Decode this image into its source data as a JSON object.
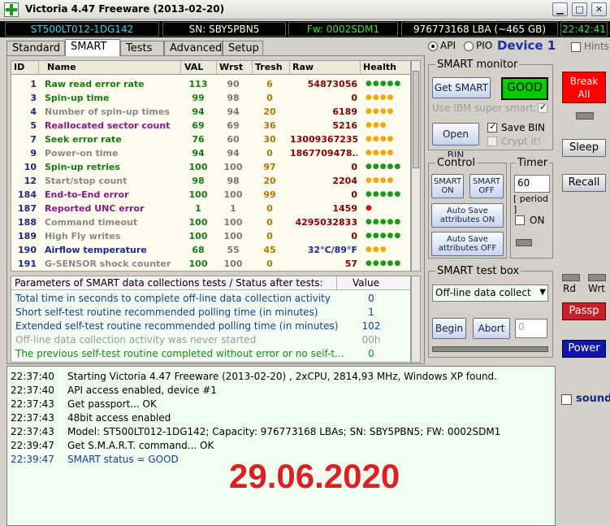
{
  "window": {
    "title": "Victoria 4.47  Freeware (2013-02-20)",
    "min_glyph": "▁",
    "max_glyph": "□",
    "close_glyph": "✕"
  },
  "infobar": {
    "model": "ST500LT012-1DG142",
    "serial": "SN: SBY5PBN5",
    "firmware": "Fw: 0002SDM1",
    "lba": "976773168 LBA (~465 GB)",
    "time": "22:42:41"
  },
  "tabs": [
    "Standard",
    "SMART",
    "Tests",
    "Advanced",
    "Setup"
  ],
  "active_tab": "SMART",
  "mode": {
    "api_label": "API",
    "pio_label": "PIO",
    "device_label": "Device 1",
    "selected": "API"
  },
  "hints_label": "Hints",
  "smart_table": {
    "headers": [
      "ID",
      "Name",
      "VAL",
      "Wrst",
      "Tresh",
      "Raw",
      "Health"
    ],
    "rows": [
      {
        "id": "1",
        "name": "Raw read error rate",
        "val": "113",
        "wrst": "90",
        "tresh": "6",
        "raw": "54873056",
        "health": "●●●●●",
        "name_color": "#177a17",
        "val_color": "#177a17",
        "health_color": "#1a9a1a"
      },
      {
        "id": "3",
        "name": "Spin-up time",
        "val": "99",
        "wrst": "98",
        "tresh": "0",
        "raw": "0",
        "health": "●●●●",
        "name_color": "#177a17",
        "val_color": "#177a17",
        "health_color": "#f2a800"
      },
      {
        "id": "4",
        "name": "Number of spin-up times",
        "val": "94",
        "wrst": "94",
        "tresh": "20",
        "raw": "6189",
        "health": "●●●●",
        "name_color": "#888888",
        "val_color": "#177a17",
        "health_color": "#f2a800"
      },
      {
        "id": "5",
        "name": "Reallocated sector count",
        "val": "69",
        "wrst": "69",
        "tresh": "36",
        "raw": "5216",
        "health": "●●●",
        "name_color": "#8a1a8a",
        "val_color": "#177a17",
        "health_color": "#f2a800"
      },
      {
        "id": "7",
        "name": "Seek error rate",
        "val": "76",
        "wrst": "60",
        "tresh": "30",
        "raw": "13009367235",
        "health": "●●●●",
        "name_color": "#177a17",
        "val_color": "#177a17",
        "health_color": "#f2a800"
      },
      {
        "id": "9",
        "name": "Power-on time",
        "val": "94",
        "wrst": "94",
        "tresh": "0",
        "raw": "1867709478...",
        "health": "●●●●",
        "name_color": "#888888",
        "val_color": "#177a17",
        "health_color": "#f2a800"
      },
      {
        "id": "10",
        "name": "Spin-up retries",
        "val": "100",
        "wrst": "100",
        "tresh": "97",
        "raw": "0",
        "health": "●●●●●",
        "name_color": "#177a17",
        "val_color": "#177a17",
        "health_color": "#1a9a1a"
      },
      {
        "id": "12",
        "name": "Start/stop count",
        "val": "98",
        "wrst": "98",
        "tresh": "20",
        "raw": "2204",
        "health": "●●●●",
        "name_color": "#888888",
        "val_color": "#177a17",
        "health_color": "#f2a800"
      },
      {
        "id": "184",
        "name": "End-to-End error",
        "val": "100",
        "wrst": "100",
        "tresh": "99",
        "raw": "0",
        "health": "●●●●●",
        "name_color": "#8a1a8a",
        "val_color": "#177a17",
        "health_color": "#1a9a1a"
      },
      {
        "id": "187",
        "name": "Reported UNC error",
        "val": "1",
        "wrst": "1",
        "tresh": "0",
        "raw": "1459",
        "health": "●",
        "name_color": "#8a1a8a",
        "val_color": "#177a17",
        "health_color": "#e01010"
      },
      {
        "id": "188",
        "name": "Command timeout",
        "val": "100",
        "wrst": "100",
        "tresh": "0",
        "raw": "4295032833",
        "health": "●●●●●",
        "name_color": "#888888",
        "val_color": "#177a17",
        "health_color": "#1a9a1a"
      },
      {
        "id": "189",
        "name": "High Fly writes",
        "val": "100",
        "wrst": "100",
        "tresh": "0",
        "raw": "0",
        "health": "●●●●●",
        "name_color": "#888888",
        "val_color": "#177a17",
        "health_color": "#1a9a1a"
      },
      {
        "id": "190",
        "name": "Airflow temperature",
        "val": "68",
        "wrst": "55",
        "tresh": "45",
        "raw": "32°C/89°F",
        "health": "●●●",
        "name_color": "#1a2a9a",
        "val_color": "#177a17",
        "health_color": "#f2a800",
        "raw_color": "#1a2a9a"
      },
      {
        "id": "191",
        "name": "G-SENSOR shock counter",
        "val": "100",
        "wrst": "100",
        "tresh": "0",
        "raw": "57",
        "health": "●●●●●",
        "name_color": "#888888",
        "val_color": "#177a17",
        "health_color": "#1a9a1a"
      }
    ]
  },
  "params": {
    "header": "Parameters of SMART data collections tests / Status after tests:",
    "value_header": "Value",
    "rows": [
      {
        "label": "Total time in seconds to complete off-line data collection activity",
        "value": "0",
        "color": "#1a3a9a"
      },
      {
        "label": "Short self-test routine recommended polling time (in minutes)",
        "value": "1",
        "color": "#1a3a9a"
      },
      {
        "label": "Extended self-test routine recommended polling time (in minutes)",
        "value": "102",
        "color": "#1a3a9a"
      },
      {
        "label": "Off-line data collection activity was never started",
        "value": "00h",
        "color": "#9a9a9a"
      },
      {
        "label": "The previous self-test routine completed without error or no self-t...",
        "value": "0",
        "color": "#1a8a1a"
      }
    ]
  },
  "smart_monitor": {
    "title": "SMART monitor",
    "get_smart": "Get SMART",
    "status": "GOOD",
    "ibm_label": "Use IBM super smart:",
    "open_bin": "Open BIN",
    "save_bin": "Save BIN",
    "crypt_it": "Crypt it!"
  },
  "control": {
    "title": "Control",
    "smart_on": "SMART ON",
    "smart_off": "SMART OFF",
    "autosave_on": "Auto Save attributes ON",
    "autosave_off": "Auto Save attributes OFF"
  },
  "timer": {
    "title": "Timer",
    "value": "60",
    "period": "[ period ]",
    "on_label": "ON"
  },
  "test_box": {
    "title": "SMART test box",
    "selected": "Off-line data collect",
    "begin": "Begin",
    "abort": "Abort",
    "counter": "0"
  },
  "side": {
    "break": "Break All",
    "sleep": "Sleep",
    "recall": "Recall",
    "rd": "Rd",
    "wrt": "Wrt",
    "passp": "Passp",
    "power": "Power",
    "sound": "sound"
  },
  "log": [
    {
      "time": "22:37:40",
      "msg": "Starting Victoria 4.47  Freeware (2013-02-20) , 2xCPU, 2814,93 MHz, Windows XP found.",
      "color": "#000000"
    },
    {
      "time": "22:37:40",
      "msg": "API access enabled, device #1",
      "color": "#000000"
    },
    {
      "time": "22:37:43",
      "msg": "Get passport... OK",
      "color": "#000000"
    },
    {
      "time": "22:37:43",
      "msg": "48bit access enabled",
      "color": "#000000"
    },
    {
      "time": "22:37:43",
      "msg": "Model: ST500LT012-1DG142; Capacity: 976773168 LBAs; SN: SBY5PBN5; FW: 0002SDM1",
      "color": "#000000"
    },
    {
      "time": "22:39:47",
      "msg": "Get S.M.A.R.T. command... OK",
      "color": "#000000"
    },
    {
      "time": "22:39:47",
      "msg": "SMART status = GOOD",
      "color": "#1a3a9a"
    }
  ],
  "date_stamp": "29.06.2020",
  "colors": {
    "status_good": "#00cc00",
    "break_red": "#ff0000",
    "passp_red": "#c8202a",
    "power_blue": "#1016a8",
    "date_red": "#e01f25"
  }
}
